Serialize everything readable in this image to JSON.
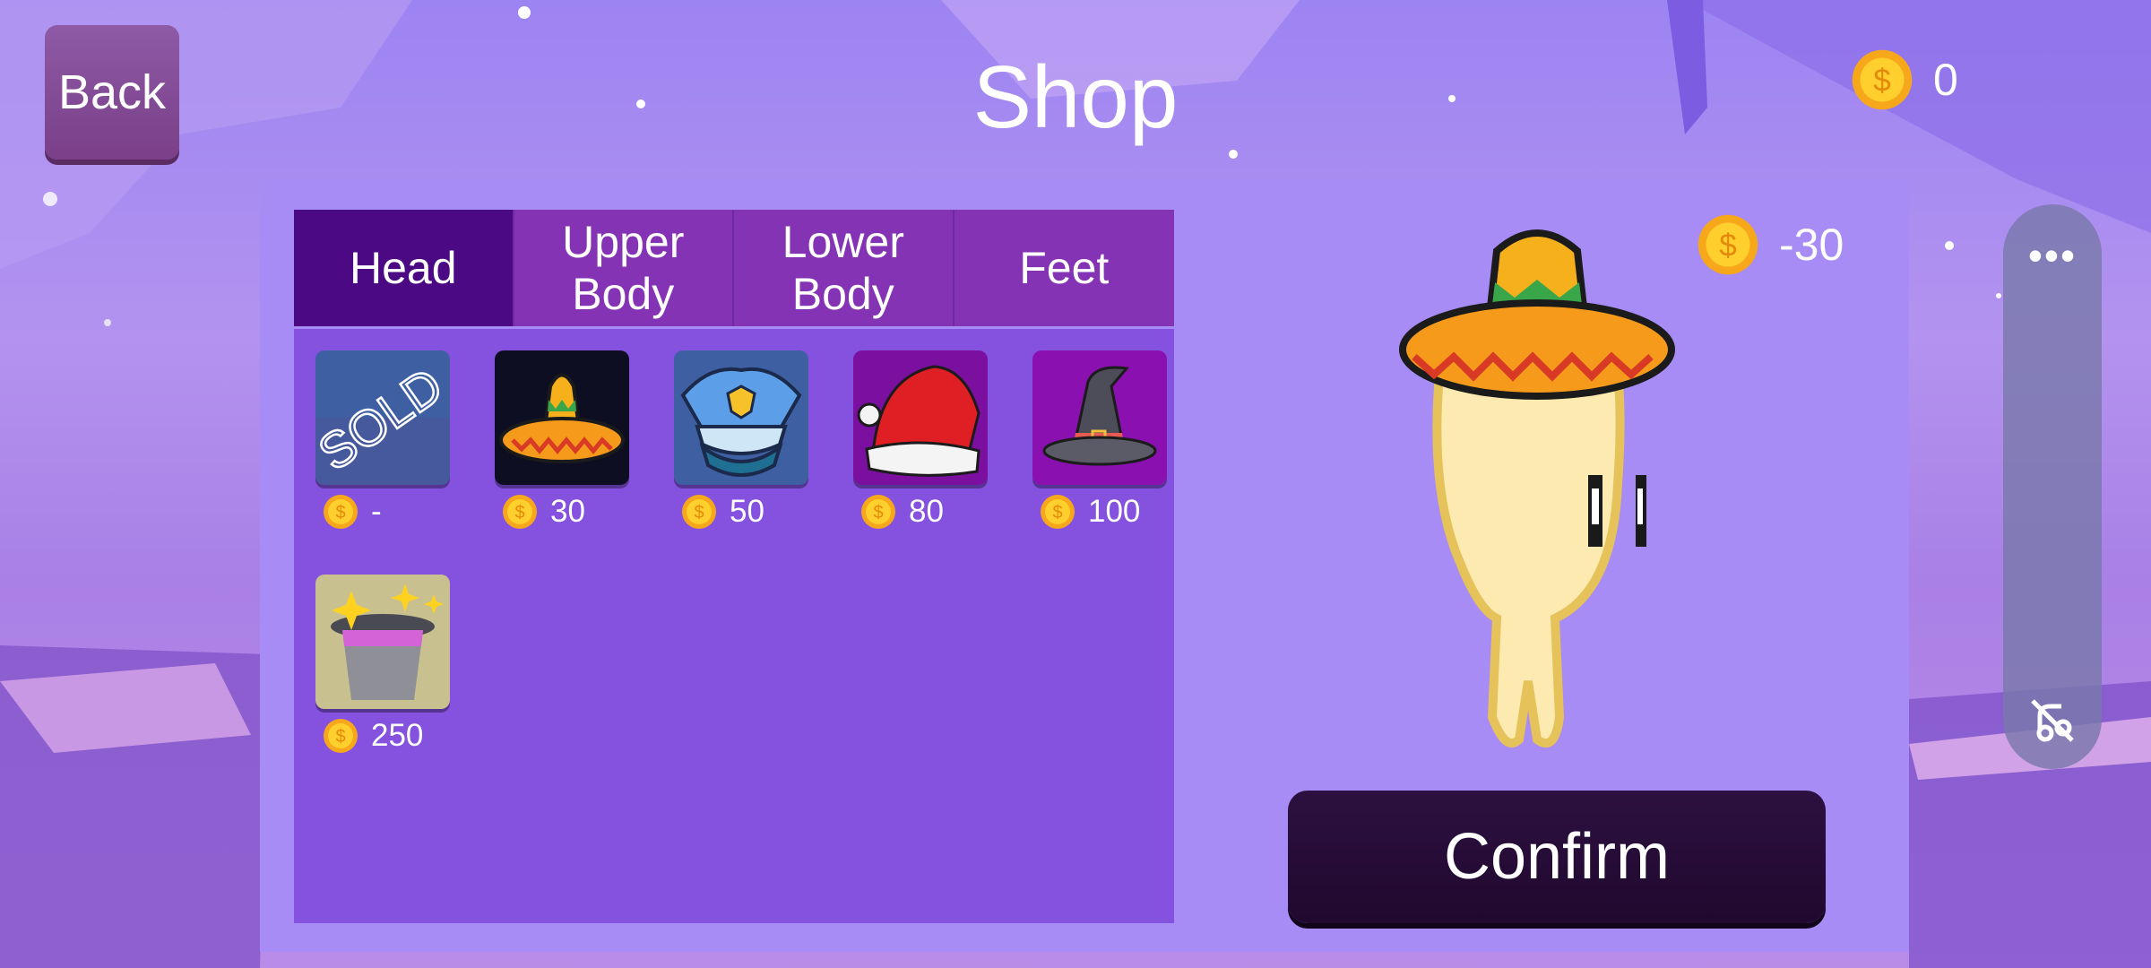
{
  "header": {
    "back_label": "Back",
    "title": "Shop",
    "coins": "0"
  },
  "tabs": [
    {
      "label": "Head",
      "active": true
    },
    {
      "label": "Upper\nBody",
      "active": false
    },
    {
      "label": "Lower\nBody",
      "active": false
    },
    {
      "label": "Feet",
      "active": false
    }
  ],
  "items": [
    {
      "name": "sold-hat",
      "overlay": "SOLD",
      "price": "-"
    },
    {
      "name": "sombrero",
      "price": "30"
    },
    {
      "name": "police-cap",
      "price": "50"
    },
    {
      "name": "santa-hat",
      "price": "80"
    },
    {
      "name": "witch-hat",
      "price": "100"
    },
    {
      "name": "magic-top-hat",
      "price": "250"
    }
  ],
  "preview": {
    "cost": "-30",
    "equipped_item": "sombrero"
  },
  "confirm_label": "Confirm",
  "side_menu": {
    "more_icon": "more-dots-icon",
    "sound_icon": "mute-icon"
  },
  "colors": {
    "panel": "#a68cf4",
    "grid": "#8552e0",
    "tab": "#8533b5",
    "tab_active": "#4b0a84",
    "confirm": "#20082e",
    "coin": "#f5b81c"
  }
}
